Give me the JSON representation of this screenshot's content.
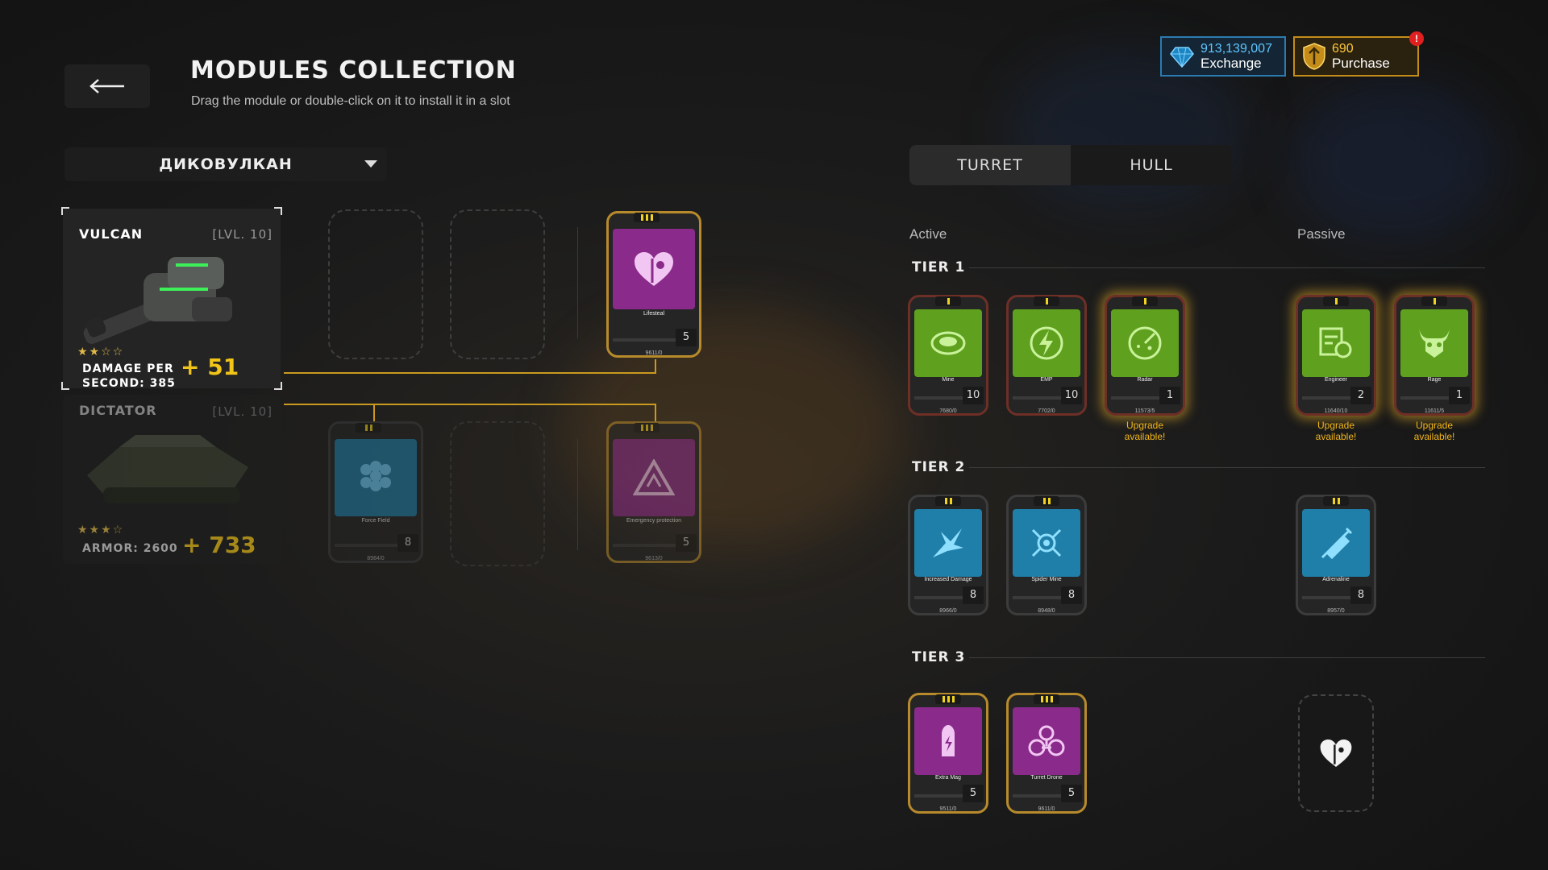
{
  "header": {
    "title": "MODULES COLLECTION",
    "subtitle": "Drag the module or double-click on it to install it in a slot",
    "back_icon": "arrow-left-icon"
  },
  "currency": {
    "gems": {
      "amount": "913,139,007",
      "action": "Exchange",
      "icon": "diamond-icon",
      "color": "#3fa8e0"
    },
    "gold": {
      "amount": "690",
      "action": "Purchase",
      "icon": "gold-shield-icon",
      "color": "#e0a21f",
      "notification": "!"
    }
  },
  "loadout_select": {
    "value": "ДИКОВУЛКАН"
  },
  "weapon": {
    "name": "VULCAN",
    "level": "[LVL. 10]",
    "stars": "★★☆☆",
    "stat_label": "DAMAGE PER SECOND: 385",
    "stat_bonus": "+ 51"
  },
  "hull": {
    "name": "DICTATOR",
    "level": "[LVL. 10]",
    "stars": "★★★☆",
    "stat_label": "ARMOR: 2600",
    "stat_bonus": "+ 733"
  },
  "installed": {
    "turret_passive": {
      "name": "Lifesteal",
      "level": "5",
      "progress": "9611/0",
      "color": "purple",
      "tier": 3
    },
    "hull_active": {
      "name": "Force Field",
      "level": "8",
      "progress": "8984/0",
      "color": "blue",
      "tier": 2
    },
    "hull_passive": {
      "name": "Emergency protection",
      "level": "5",
      "progress": "9613/0",
      "color": "purple",
      "tier": 3
    }
  },
  "tabs": {
    "turret": "TURRET",
    "hull": "HULL",
    "active": "turret"
  },
  "sections": {
    "active": "Active",
    "passive": "Passive"
  },
  "tiers": {
    "tier1": {
      "label": "TIER 1",
      "modules": [
        {
          "name": "Mine",
          "level": "10",
          "progress": "7680/0",
          "icon": "mine-icon"
        },
        {
          "name": "EMP",
          "level": "10",
          "progress": "7702/0",
          "icon": "emp-icon"
        },
        {
          "name": "Radar",
          "level": "1",
          "progress": "11573/5",
          "icon": "radar-icon",
          "upgrade": "Upgrade available!"
        },
        {
          "name": "Engineer",
          "level": "2",
          "progress": "11640/10",
          "icon": "engineer-icon",
          "upgrade": "Upgrade available!"
        },
        {
          "name": "Rage",
          "level": "1",
          "progress": "11611/5",
          "icon": "rage-icon",
          "upgrade": "Upgrade available!"
        }
      ]
    },
    "tier2": {
      "label": "TIER 2",
      "modules": [
        {
          "name": "Increased Damage",
          "level": "8",
          "progress": "8966/0",
          "icon": "increased-damage-icon"
        },
        {
          "name": "Spider Mine",
          "level": "8",
          "progress": "8948/0",
          "icon": "spider-mine-icon"
        },
        {
          "name": "Adrenaline",
          "level": "8",
          "progress": "8957/0",
          "icon": "adrenaline-icon"
        }
      ]
    },
    "tier3": {
      "label": "TIER 3",
      "modules": [
        {
          "name": "Extra Mag",
          "level": "5",
          "progress": "9511/0",
          "icon": "extra-mag-icon"
        },
        {
          "name": "Turret Drone",
          "level": "5",
          "progress": "9611/0",
          "icon": "turret-drone-icon"
        }
      ],
      "installed_placeholder": "lifesteal-heart-icon"
    }
  },
  "colors": {
    "green": "#5fa11f",
    "blue": "#1f7fa8",
    "purple": "#8a2a8a",
    "gold": "#c99a1f"
  }
}
